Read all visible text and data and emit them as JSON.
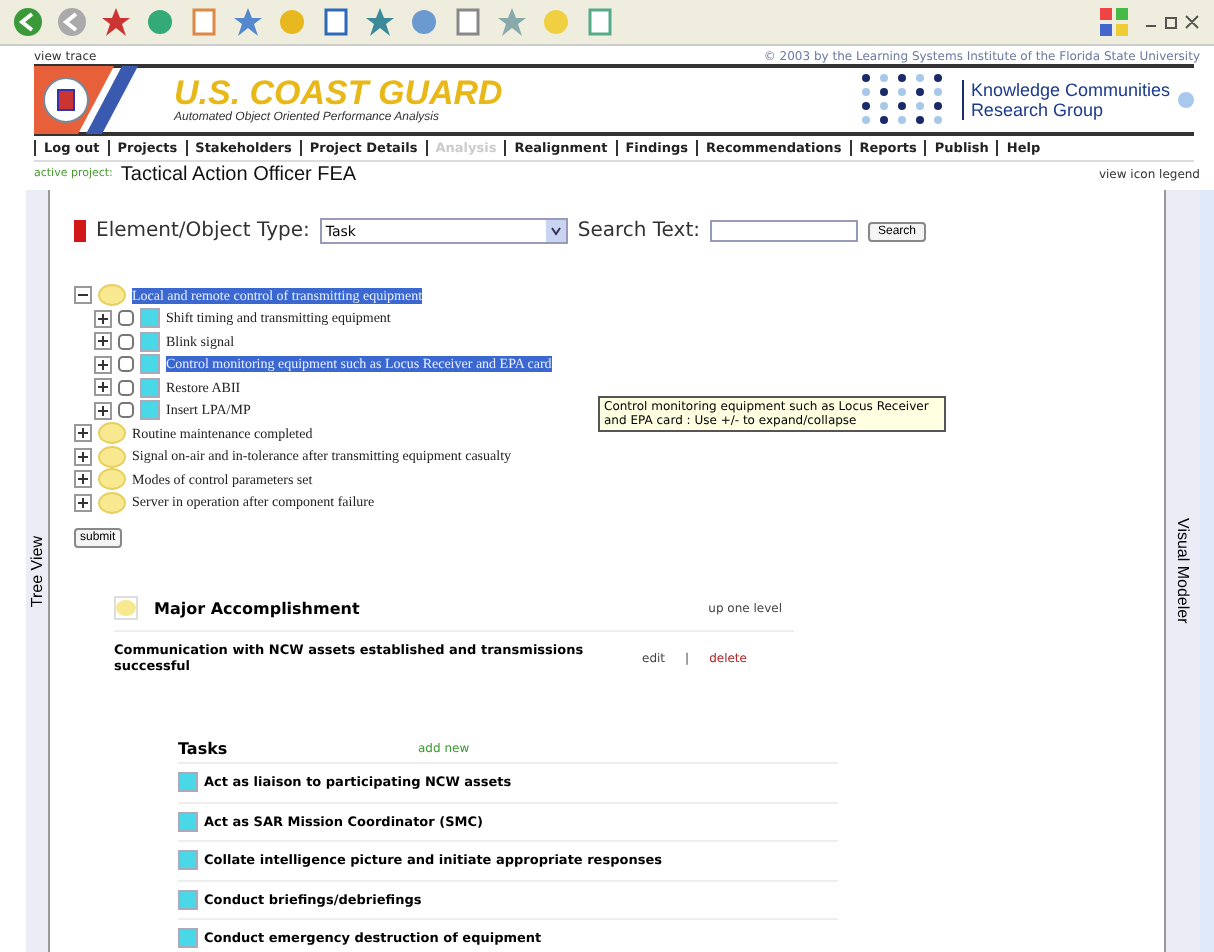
{
  "top_strip": {
    "left_link": "view trace",
    "copyright": "© 2003 by the Learning Systems Institute of the Florida State University"
  },
  "header": {
    "title": "U.S. COAST GUARD",
    "subtitle": "Automated Object Oriented Performance Analysis",
    "partner_line1": "Knowledge Communities",
    "partner_line2": "Research Group"
  },
  "nav": [
    {
      "label": "Log out",
      "disabled": false
    },
    {
      "label": "Projects",
      "disabled": false
    },
    {
      "label": "Stakeholders",
      "disabled": false
    },
    {
      "label": "Project Details",
      "disabled": false
    },
    {
      "label": "Analysis",
      "disabled": true
    },
    {
      "label": "Realignment",
      "disabled": false
    },
    {
      "label": "Findings",
      "disabled": false
    },
    {
      "label": "Recommendations",
      "disabled": false
    },
    {
      "label": "Reports",
      "disabled": false
    },
    {
      "label": "Publish",
      "disabled": false
    },
    {
      "label": "Help",
      "disabled": false
    }
  ],
  "active_project": {
    "label": "active project:",
    "name": "Tactical Action Officer FEA",
    "legend_link": "view icon legend"
  },
  "side_tabs": {
    "left": "Tree View",
    "right": "Visual Modeler"
  },
  "filter": {
    "type_label": "Element/Object Type:",
    "type_value": "Task",
    "search_label": "Search Text:",
    "search_button": "Search"
  },
  "tree": [
    {
      "label": "Local and remote control of transmitting equipment",
      "expanded": true,
      "selected": true,
      "children": [
        {
          "label": "Shift timing and transmitting equipment",
          "expanded": false,
          "selected": false,
          "checked": false
        },
        {
          "label": "Blink signal",
          "expanded": false,
          "selected": false,
          "checked": false
        },
        {
          "label": "Control monitoring equipment such as Locus Receiver and EPA card",
          "expanded": false,
          "selected": true,
          "checked": false
        },
        {
          "label": "Restore ABII",
          "expanded": false,
          "selected": false,
          "checked": false
        },
        {
          "label": "Insert LPA/MP",
          "expanded": false,
          "selected": false,
          "checked": false
        }
      ]
    },
    {
      "label": "Routine maintenance completed",
      "expanded": false,
      "selected": false
    },
    {
      "label": "Signal on-air and in-tolerance after transmitting equipment casualty",
      "expanded": false,
      "selected": false
    },
    {
      "label": "Modes of control parameters set",
      "expanded": false,
      "selected": false
    },
    {
      "label": "Server in operation after component failure",
      "expanded": false,
      "selected": false
    }
  ],
  "tooltip": "Control monitoring equipment such as Locus Receiver and EPA card : Use +/- to expand/collapse",
  "submit_button": "submit",
  "major": {
    "heading": "Major Accomplishment",
    "up_link": "up one level",
    "text": "Communication with NCW assets established and transmissions successful",
    "edit_link": "edit",
    "separator": "|",
    "delete_link": "delete"
  },
  "tasks": {
    "heading": "Tasks",
    "add_link": "add new",
    "items": [
      "Act as liaison to participating NCW assets",
      "Act as SAR Mission Coordinator (SMC)",
      "Collate intelligence picture and initiate appropriate responses",
      "Conduct briefings/debriefings",
      "Conduct emergency destruction of equipment"
    ]
  }
}
